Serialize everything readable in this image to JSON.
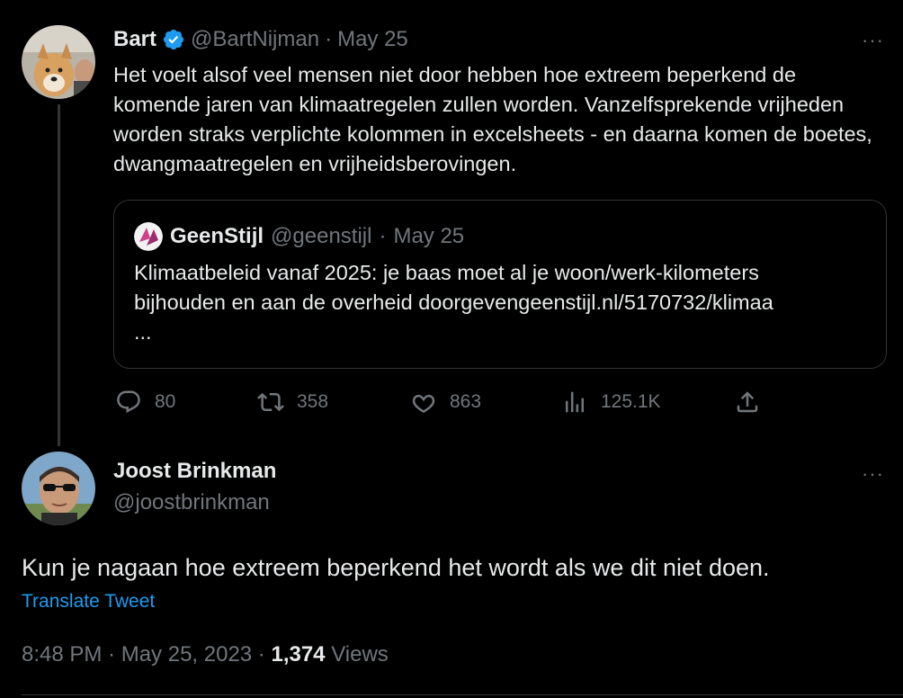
{
  "tweet": {
    "author_name": "Bart",
    "author_handle": "@BartNijman",
    "date": "May 25",
    "text": "Het voelt alsof veel mensen niet door hebben hoe extreem beperkend de komende jaren van klimaatregelen zullen worden. Vanzelfsprekende vrijheden worden straks verplichte kolommen in excelsheets - en daarna komen de boetes, dwangmaatregelen en vrijheidsberovingen.",
    "more_label": "···",
    "verified_icon": "verified-badge-icon",
    "quote": {
      "author_name": "GeenStijl",
      "author_handle": "@geenstijl",
      "date": "May 25",
      "text_line1": "Klimaatbeleid vanaf 2025: je baas moet al je woon/werk-kilometers",
      "text_line2": "bijhouden en aan de overheid doorgevengeenstijl.nl/5170732/klimaa",
      "text_line3": "..."
    },
    "actions": {
      "replies": "80",
      "retweets": "358",
      "likes": "863",
      "views": "125.1K"
    }
  },
  "reply": {
    "author_name": "Joost Brinkman",
    "author_handle": "@joostbrinkman",
    "more_label": "···",
    "text": "Kun je nagaan hoe extreem beperkend het wordt als we dit niet doen.",
    "translate_label": "Translate Tweet",
    "time": "8:48 PM · May 25, 2023 · ",
    "views_count": "1,374",
    "views_label": " Views"
  },
  "colors": {
    "background": "#000000",
    "text": "#e7e9ea",
    "muted": "#71767b",
    "accent": "#1d9bf0",
    "border": "#2f3336"
  }
}
